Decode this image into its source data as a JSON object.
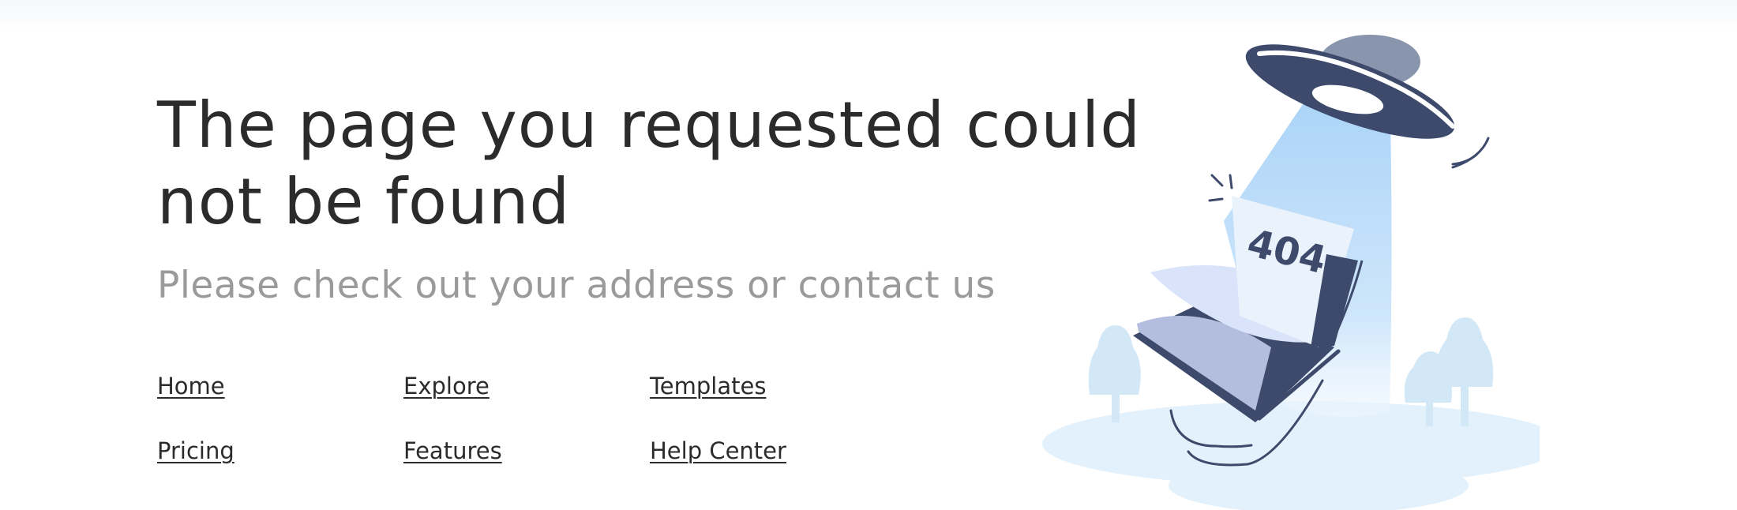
{
  "error": {
    "headline": "The page you requested could not be found",
    "subline": "Please check out your address or contact us"
  },
  "nav_links": [
    {
      "label": "Home"
    },
    {
      "label": "Explore"
    },
    {
      "label": "Templates"
    },
    {
      "label": "Pricing"
    },
    {
      "label": "Features"
    },
    {
      "label": "Help Center"
    }
  ],
  "illustration": {
    "page_label": "404",
    "icons": [
      "ufo-icon",
      "book-icon",
      "tree-icon"
    ],
    "colors": {
      "ufo": "#3d4a6b",
      "beam": "#a9d3f7",
      "ground": "#e2f1fb",
      "trees": "#d3e8f7",
      "book_page": "#b3bedf",
      "book_cover": "#3d4a6b"
    }
  }
}
